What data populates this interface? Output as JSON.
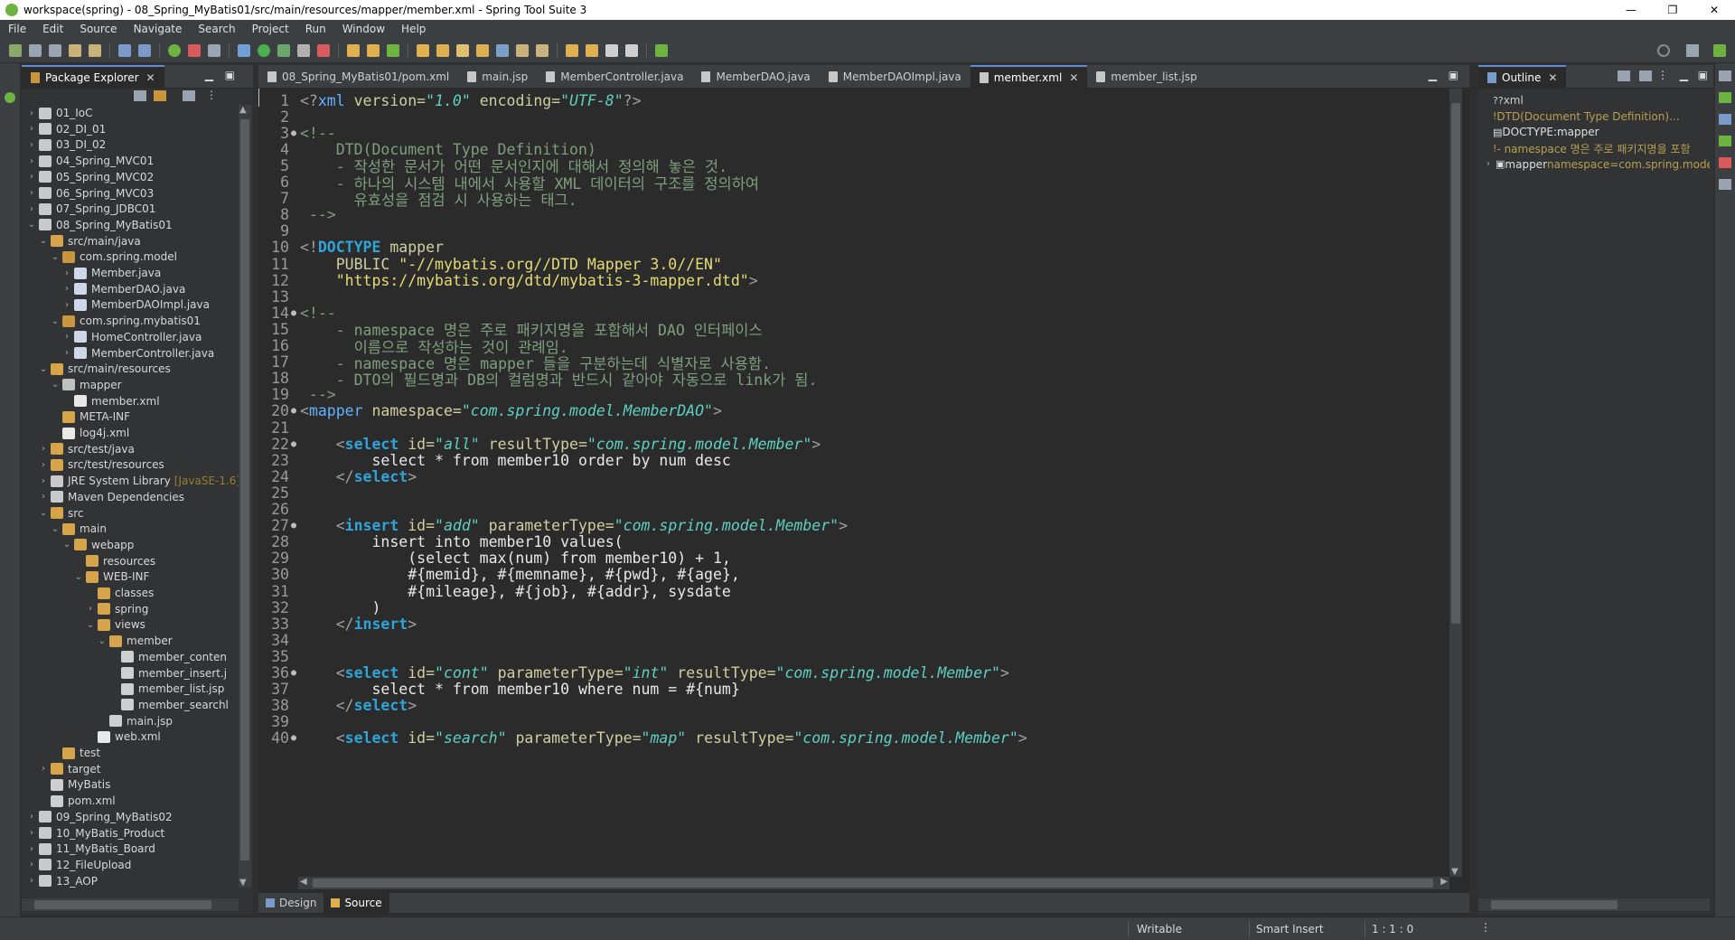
{
  "window": {
    "title": "workspace(spring) - 08_Spring_MyBatis01/src/main/resources/mapper/member.xml - Spring Tool Suite 3",
    "controls": [
      "—",
      "❐",
      "✕"
    ]
  },
  "menu": [
    "File",
    "Edit",
    "Source",
    "Navigate",
    "Search",
    "Project",
    "Run",
    "Window",
    "Help"
  ],
  "explorer": {
    "title": "Package Explorer",
    "items": [
      {
        "label": "01_IoC",
        "depth": 0,
        "chev": ">",
        "icon": "project-icon",
        "color": "#c9c9c9"
      },
      {
        "label": "02_DI_01",
        "depth": 0,
        "chev": ">",
        "icon": "project-icon",
        "color": "#c9c9c9"
      },
      {
        "label": "03_DI_02",
        "depth": 0,
        "chev": ">",
        "icon": "project-icon",
        "color": "#c9c9c9"
      },
      {
        "label": "04_Spring_MVC01",
        "depth": 0,
        "chev": ">",
        "icon": "project-icon",
        "color": "#c9c9c9"
      },
      {
        "label": "05_Spring_MVC02",
        "depth": 0,
        "chev": ">",
        "icon": "project-icon",
        "color": "#c9c9c9"
      },
      {
        "label": "06_Spring_MVC03",
        "depth": 0,
        "chev": ">",
        "icon": "project-icon",
        "color": "#c9c9c9"
      },
      {
        "label": "07_Spring_JDBC01",
        "depth": 0,
        "chev": ">",
        "icon": "project-icon",
        "color": "#c9c9c9"
      },
      {
        "label": "08_Spring_MyBatis01",
        "depth": 0,
        "chev": "v",
        "icon": "project-icon",
        "color": "#c9c9c9"
      },
      {
        "label": "src/main/java",
        "depth": 1,
        "chev": "v",
        "icon": "source-folder-icon",
        "color": "#d6a44a"
      },
      {
        "label": "com.spring.model",
        "depth": 2,
        "chev": "v",
        "icon": "package-icon",
        "color": "#c8963c"
      },
      {
        "label": "Member.java",
        "depth": 3,
        "chev": ">",
        "icon": "java-file-icon",
        "color": "#cfd8e8"
      },
      {
        "label": "MemberDAO.java",
        "depth": 3,
        "chev": ">",
        "icon": "java-file-icon",
        "color": "#cfd8e8"
      },
      {
        "label": "MemberDAOImpl.java",
        "depth": 3,
        "chev": ">",
        "icon": "java-file-icon",
        "color": "#cfd8e8"
      },
      {
        "label": "com.spring.mybatis01",
        "depth": 2,
        "chev": "v",
        "icon": "package-icon",
        "color": "#c8963c"
      },
      {
        "label": "HomeController.java",
        "depth": 3,
        "chev": ">",
        "icon": "java-file-icon",
        "color": "#cfd8e8"
      },
      {
        "label": "MemberController.java",
        "depth": 3,
        "chev": ">",
        "icon": "java-file-icon",
        "color": "#cfd8e8"
      },
      {
        "label": "src/main/resources",
        "depth": 1,
        "chev": "v",
        "icon": "source-folder-icon",
        "color": "#d6a44a"
      },
      {
        "label": "mapper",
        "depth": 2,
        "chev": "v",
        "icon": "folder-icon",
        "color": "#bfbfbf"
      },
      {
        "label": "member.xml",
        "depth": 3,
        "chev": "",
        "icon": "xml-file-icon",
        "color": "#e8e8e8"
      },
      {
        "label": "META-INF",
        "depth": 2,
        "chev": "",
        "icon": "folder-icon",
        "color": "#d6a44a"
      },
      {
        "label": "log4j.xml",
        "depth": 2,
        "chev": "",
        "icon": "xml-file-icon",
        "color": "#e8e8e8"
      },
      {
        "label": "src/test/java",
        "depth": 1,
        "chev": ">",
        "icon": "source-folder-icon",
        "color": "#d6a44a"
      },
      {
        "label": "src/test/resources",
        "depth": 1,
        "chev": ">",
        "icon": "source-folder-icon",
        "color": "#d6a44a"
      },
      {
        "label": "JRE System Library",
        "depth": 1,
        "chev": ">",
        "icon": "library-icon",
        "color": "#c9c9c9",
        "decoration": "[JavaSE-1.6]"
      },
      {
        "label": "Maven Dependencies",
        "depth": 1,
        "chev": ">",
        "icon": "library-icon",
        "color": "#c9c9c9"
      },
      {
        "label": "src",
        "depth": 1,
        "chev": "v",
        "icon": "folder-icon",
        "color": "#d6a44a"
      },
      {
        "label": "main",
        "depth": 2,
        "chev": "v",
        "icon": "folder-icon",
        "color": "#d6a44a"
      },
      {
        "label": "webapp",
        "depth": 3,
        "chev": "v",
        "icon": "folder-icon",
        "color": "#d6a44a"
      },
      {
        "label": "resources",
        "depth": 4,
        "chev": "",
        "icon": "folder-icon",
        "color": "#d6a44a"
      },
      {
        "label": "WEB-INF",
        "depth": 4,
        "chev": "v",
        "icon": "folder-icon",
        "color": "#d6a44a"
      },
      {
        "label": "classes",
        "depth": 5,
        "chev": "",
        "icon": "folder-icon",
        "color": "#d6a44a"
      },
      {
        "label": "spring",
        "depth": 5,
        "chev": ">",
        "icon": "folder-icon",
        "color": "#d6a44a"
      },
      {
        "label": "views",
        "depth": 5,
        "chev": "v",
        "icon": "folder-icon",
        "color": "#d6a44a"
      },
      {
        "label": "member",
        "depth": 6,
        "chev": "v",
        "icon": "folder-icon",
        "color": "#d6a44a"
      },
      {
        "label": "member_conten",
        "depth": 7,
        "chev": "",
        "icon": "jsp-file-icon",
        "color": "#cfcfcf"
      },
      {
        "label": "member_insert.j",
        "depth": 7,
        "chev": "",
        "icon": "jsp-file-icon",
        "color": "#cfcfcf"
      },
      {
        "label": "member_list.jsp",
        "depth": 7,
        "chev": "",
        "icon": "jsp-file-icon",
        "color": "#cfcfcf"
      },
      {
        "label": "member_searchl",
        "depth": 7,
        "chev": "",
        "icon": "jsp-file-icon",
        "color": "#cfcfcf"
      },
      {
        "label": "main.jsp",
        "depth": 6,
        "chev": "",
        "icon": "jsp-file-icon",
        "color": "#cfcfcf"
      },
      {
        "label": "web.xml",
        "depth": 5,
        "chev": "",
        "icon": "xml-file-icon",
        "color": "#e8e8e8"
      },
      {
        "label": "test",
        "depth": 2,
        "chev": "",
        "icon": "folder-icon",
        "color": "#d6a44a"
      },
      {
        "label": "target",
        "depth": 1,
        "chev": ">",
        "icon": "folder-icon",
        "color": "#d6a44a"
      },
      {
        "label": "MyBatis",
        "depth": 1,
        "chev": "",
        "icon": "file-icon",
        "color": "#cfcfcf"
      },
      {
        "label": "pom.xml",
        "depth": 1,
        "chev": "",
        "icon": "file-icon",
        "color": "#cfcfcf"
      },
      {
        "label": "09_Spring_MyBatis02",
        "depth": 0,
        "chev": ">",
        "icon": "project-icon",
        "color": "#c9c9c9"
      },
      {
        "label": "10_MyBatis_Product",
        "depth": 0,
        "chev": ">",
        "icon": "project-icon",
        "color": "#c9c9c9"
      },
      {
        "label": "11_MyBatis_Board",
        "depth": 0,
        "chev": ">",
        "icon": "project-icon",
        "color": "#c9c9c9"
      },
      {
        "label": "12_FileUpload",
        "depth": 0,
        "chev": ">",
        "icon": "project-icon",
        "color": "#c9c9c9"
      },
      {
        "label": "13_AOP",
        "depth": 0,
        "chev": ">",
        "icon": "project-icon",
        "color": "#c9c9c9"
      }
    ]
  },
  "editor": {
    "tabs": [
      {
        "label": "08_Spring_MyBatis01/pom.xml",
        "active": false
      },
      {
        "label": "main.jsp",
        "active": false
      },
      {
        "label": "MemberController.java",
        "active": false
      },
      {
        "label": "MemberDAO.java",
        "active": false
      },
      {
        "label": "MemberDAOImpl.java",
        "active": false
      },
      {
        "label": "member.xml",
        "active": true
      },
      {
        "label": "member_list.jsp",
        "active": false
      }
    ],
    "lines": [
      {
        "n": "1",
        "fold": "",
        "segs": [
          [
            "pun",
            "<?"
          ],
          [
            "tag",
            "xml "
          ],
          [
            "attr",
            "version="
          ],
          [
            "val",
            "\"1.0\""
          ],
          [
            "attr",
            " encoding="
          ],
          [
            "val",
            "\"UTF-8\""
          ],
          [
            "pun",
            "?>"
          ]
        ]
      },
      {
        "n": "2",
        "fold": "",
        "segs": []
      },
      {
        "n": "3",
        "fold": "●",
        "segs": [
          [
            "cmt",
            "<!--"
          ]
        ]
      },
      {
        "n": "4",
        "fold": "",
        "segs": [
          [
            "cmt",
            "    DTD(Document Type Definition)"
          ]
        ]
      },
      {
        "n": "5",
        "fold": "",
        "segs": [
          [
            "cmt",
            "    - 작성한 문서가 어떤 문서인지에 대해서 정의해 놓은 것."
          ]
        ]
      },
      {
        "n": "6",
        "fold": "",
        "segs": [
          [
            "cmt",
            "    - 하나의 시스템 내에서 사용할 XML 데이터의 구조를 정의하여"
          ]
        ]
      },
      {
        "n": "7",
        "fold": "",
        "segs": [
          [
            "cmt",
            "      유효성을 점검 시 사용하는 태그."
          ]
        ]
      },
      {
        "n": "8",
        "fold": "",
        "segs": [
          [
            "cmt",
            " -->"
          ]
        ]
      },
      {
        "n": "9",
        "fold": "",
        "segs": []
      },
      {
        "n": "10",
        "fold": "",
        "segs": [
          [
            "pun",
            "<!"
          ],
          [
            "kw",
            "DOCTYPE"
          ],
          [
            "attr",
            " mapper"
          ]
        ]
      },
      {
        "n": "11",
        "fold": "",
        "segs": [
          [
            "attr",
            "    PUBLIC "
          ],
          [
            "str",
            "\"-//mybatis.org//DTD Mapper 3.0//EN\""
          ]
        ]
      },
      {
        "n": "12",
        "fold": "",
        "segs": [
          [
            "str",
            "    \"https://mybatis.org/dtd/mybatis-3-mapper.dtd\""
          ],
          [
            "pun",
            ">"
          ]
        ]
      },
      {
        "n": "13",
        "fold": "",
        "segs": []
      },
      {
        "n": "14",
        "fold": "●",
        "segs": [
          [
            "cmt",
            "<!--"
          ]
        ]
      },
      {
        "n": "15",
        "fold": "",
        "segs": [
          [
            "cmt",
            "    - namespace 명은 주로 패키지명을 포함해서 DAO 인터페이스"
          ]
        ]
      },
      {
        "n": "16",
        "fold": "",
        "segs": [
          [
            "cmt",
            "      이름으로 작성하는 것이 관례임."
          ]
        ]
      },
      {
        "n": "17",
        "fold": "",
        "segs": [
          [
            "cmt",
            "    - namespace 명은 mapper 들을 구분하는데 식별자로 사용함."
          ]
        ]
      },
      {
        "n": "18",
        "fold": "",
        "segs": [
          [
            "cmt",
            "    - DTO의 필드명과 DB의 컬럼명과 반드시 같아야 자동으로 link가 됨."
          ]
        ]
      },
      {
        "n": "19",
        "fold": "",
        "segs": [
          [
            "cmt",
            " -->"
          ]
        ]
      },
      {
        "n": "20",
        "fold": "●",
        "segs": [
          [
            "pun",
            "<"
          ],
          [
            "tag",
            "mapper"
          ],
          [
            "attr",
            " namespace="
          ],
          [
            "val",
            "\"com.spring.model.MemberDAO\""
          ],
          [
            "pun",
            ">"
          ]
        ]
      },
      {
        "n": "21",
        "fold": "",
        "segs": []
      },
      {
        "n": "22",
        "fold": "●",
        "segs": [
          [
            "pun",
            "    <"
          ],
          [
            "kw",
            "select"
          ],
          [
            "attr",
            " id="
          ],
          [
            "val",
            "\"all\""
          ],
          [
            "attr",
            " resultType="
          ],
          [
            "val",
            "\"com.spring.model.Member\""
          ],
          [
            "pun",
            ">"
          ]
        ]
      },
      {
        "n": "23",
        "fold": "",
        "segs": [
          [
            "sql",
            "        select * from member10 order by num desc"
          ]
        ]
      },
      {
        "n": "24",
        "fold": "",
        "segs": [
          [
            "pun",
            "    </"
          ],
          [
            "kw",
            "select"
          ],
          [
            "pun",
            ">"
          ]
        ]
      },
      {
        "n": "25",
        "fold": "",
        "segs": []
      },
      {
        "n": "26",
        "fold": "",
        "segs": []
      },
      {
        "n": "27",
        "fold": "●",
        "segs": [
          [
            "pun",
            "    <"
          ],
          [
            "kw",
            "insert"
          ],
          [
            "attr",
            " id="
          ],
          [
            "val",
            "\"add\""
          ],
          [
            "attr",
            " parameterType="
          ],
          [
            "val",
            "\"com.spring.model.Member\""
          ],
          [
            "pun",
            ">"
          ]
        ]
      },
      {
        "n": "28",
        "fold": "",
        "segs": [
          [
            "sql",
            "        insert into member10 values("
          ]
        ]
      },
      {
        "n": "29",
        "fold": "",
        "segs": [
          [
            "sql",
            "            (select max(num) from member10) + 1,"
          ]
        ]
      },
      {
        "n": "30",
        "fold": "",
        "segs": [
          [
            "sql",
            "            #{memid}, #{memname}, #{pwd}, #{age},"
          ]
        ]
      },
      {
        "n": "31",
        "fold": "",
        "segs": [
          [
            "sql",
            "            #{mileage}, #{job}, #{addr}, sysdate"
          ]
        ]
      },
      {
        "n": "32",
        "fold": "",
        "segs": [
          [
            "sql",
            "        )"
          ]
        ]
      },
      {
        "n": "33",
        "fold": "",
        "segs": [
          [
            "pun",
            "    </"
          ],
          [
            "kw",
            "insert"
          ],
          [
            "pun",
            ">"
          ]
        ]
      },
      {
        "n": "34",
        "fold": "",
        "segs": []
      },
      {
        "n": "35",
        "fold": "",
        "segs": []
      },
      {
        "n": "36",
        "fold": "●",
        "segs": [
          [
            "pun",
            "    <"
          ],
          [
            "kw",
            "select"
          ],
          [
            "attr",
            " id="
          ],
          [
            "val",
            "\"cont\""
          ],
          [
            "attr",
            " parameterType="
          ],
          [
            "val",
            "\"int\""
          ],
          [
            "attr",
            " resultType="
          ],
          [
            "val",
            "\"com.spring.model.Member\""
          ],
          [
            "pun",
            ">"
          ]
        ]
      },
      {
        "n": "37",
        "fold": "",
        "segs": [
          [
            "sql",
            "        select * from member10 where num = #{num}"
          ]
        ]
      },
      {
        "n": "38",
        "fold": "",
        "segs": [
          [
            "pun",
            "    </"
          ],
          [
            "kw",
            "select"
          ],
          [
            "pun",
            ">"
          ]
        ]
      },
      {
        "n": "39",
        "fold": "",
        "segs": []
      },
      {
        "n": "40",
        "fold": "●",
        "segs": [
          [
            "pun",
            "    <"
          ],
          [
            "kw",
            "select"
          ],
          [
            "attr",
            " id="
          ],
          [
            "val",
            "\"search\""
          ],
          [
            "attr",
            " parameterType="
          ],
          [
            "val",
            "\"map\""
          ],
          [
            "attr",
            " resultType="
          ],
          [
            "val",
            "\"com.spring.model.Member\""
          ],
          [
            "pun",
            ">"
          ]
        ]
      }
    ],
    "bottom_tabs": [
      {
        "label": "Design",
        "active": false
      },
      {
        "label": "Source",
        "active": true
      }
    ]
  },
  "outline": {
    "title": "Outline",
    "items": [
      {
        "icon": "?? ",
        "label": "xml",
        "depth": 0,
        "color": "#cfcfcf"
      },
      {
        "icon": "! ",
        "label": "DTD(Document Type Definition)...",
        "depth": 0,
        "color": "#b8a050"
      },
      {
        "icon": "▤ ",
        "label": "DOCTYPE:mapper",
        "depth": 0,
        "color": "#e0e0e0"
      },
      {
        "icon": "! ",
        "label": "- namespace 명은 주로 패키지명을 포함",
        "depth": 0,
        "color": "#b8a050"
      },
      {
        "icon": "▣ ",
        "label": "mapper",
        "depth": 0,
        "color": "#e0e0e0",
        "extra": " namespace=com.spring.model.M"
      }
    ]
  },
  "status": {
    "writable": "Writable",
    "insert_mode": "Smart Insert",
    "position": "1 : 1 : 0"
  }
}
